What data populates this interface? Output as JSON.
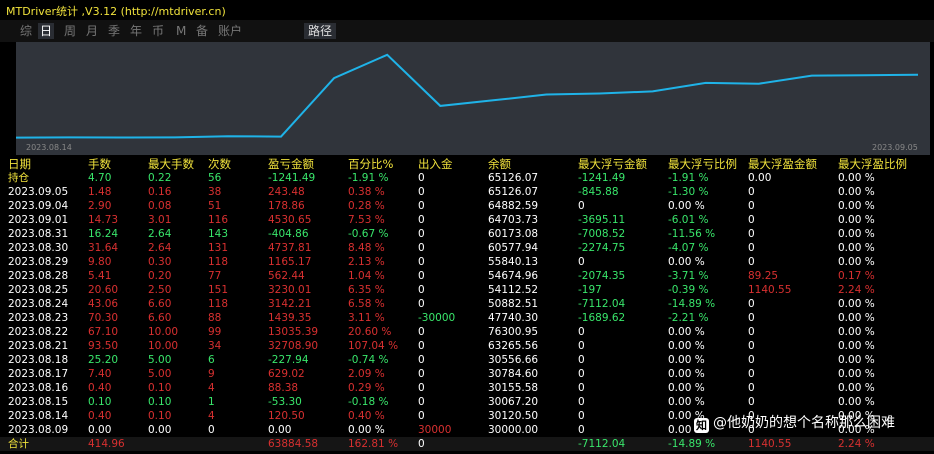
{
  "window": {
    "title": "MTDriver统计 ,V3.12 (http://mtdriver.cn)"
  },
  "tabs": [
    {
      "label": "综",
      "active": false
    },
    {
      "label": "日",
      "active": true
    },
    {
      "label": "周",
      "active": false
    },
    {
      "label": "月",
      "active": false
    },
    {
      "label": "季",
      "active": false
    },
    {
      "label": "年",
      "active": false
    },
    {
      "label": "币",
      "active": false
    },
    {
      "label": "M",
      "active": false
    },
    {
      "label": "备",
      "active": false
    },
    {
      "label": "账户",
      "active": false
    }
  ],
  "path_tab": "路径",
  "chart": {
    "start_label": "2023.08.14",
    "end_label": "2023.09.05",
    "line_color": "#1fb3e8",
    "equity": [
      30000.0,
      30120.5,
      30067.2,
      30155.58,
      30784.6,
      30556.66,
      63265.56,
      76300.95,
      47740.3,
      50882.51,
      54112.52,
      54674.96,
      55840.13,
      60577.94,
      60173.08,
      64703.73,
      64882.59,
      65126.07
    ]
  },
  "colors": {
    "green": "#39e66b",
    "red": "#d83030",
    "white": "#ffffff",
    "header": "#f0e23c"
  },
  "headers": [
    "日期",
    "手数",
    "最大手数",
    "次数",
    "盈亏金额",
    "百分比%",
    "出入金",
    "余额",
    "最大浮亏金额",
    "最大浮亏比例",
    "最大浮盈金额",
    "最大浮盈比例"
  ],
  "rows": [
    [
      "持仓",
      "4.70",
      "0.22",
      "56",
      "-1241.49",
      "-1.91 %",
      "0",
      "65126.07",
      "-1241.49",
      "-1.91 %",
      "0.00",
      "0.00 %"
    ],
    [
      "2023.09.05",
      "1.48",
      "0.16",
      "38",
      "243.48",
      "0.38 %",
      "0",
      "65126.07",
      "-845.88",
      "-1.30 %",
      "0",
      "0.00 %"
    ],
    [
      "2023.09.04",
      "2.90",
      "0.08",
      "51",
      "178.86",
      "0.28 %",
      "0",
      "64882.59",
      "0",
      "0.00 %",
      "0",
      "0.00 %"
    ],
    [
      "2023.09.01",
      "14.73",
      "3.01",
      "116",
      "4530.65",
      "7.53 %",
      "0",
      "64703.73",
      "-3695.11",
      "-6.01 %",
      "0",
      "0.00 %"
    ],
    [
      "2023.08.31",
      "16.24",
      "2.64",
      "143",
      "-404.86",
      "-0.67 %",
      "0",
      "60173.08",
      "-7008.52",
      "-11.56 %",
      "0",
      "0.00 %"
    ],
    [
      "2023.08.30",
      "31.64",
      "2.64",
      "131",
      "4737.81",
      "8.48 %",
      "0",
      "60577.94",
      "-2274.75",
      "-4.07 %",
      "0",
      "0.00 %"
    ],
    [
      "2023.08.29",
      "9.80",
      "0.30",
      "118",
      "1165.17",
      "2.13 %",
      "0",
      "55840.13",
      "0",
      "0.00 %",
      "0",
      "0.00 %"
    ],
    [
      "2023.08.28",
      "5.41",
      "0.20",
      "77",
      "562.44",
      "1.04 %",
      "0",
      "54674.96",
      "-2074.35",
      "-3.71 %",
      "89.25",
      "0.17 %"
    ],
    [
      "2023.08.25",
      "20.60",
      "2.50",
      "151",
      "3230.01",
      "6.35 %",
      "0",
      "54112.52",
      "-197",
      "-0.39 %",
      "1140.55",
      "2.24 %"
    ],
    [
      "2023.08.24",
      "43.06",
      "6.60",
      "118",
      "3142.21",
      "6.58 %",
      "0",
      "50882.51",
      "-7112.04",
      "-14.89 %",
      "0",
      "0.00 %"
    ],
    [
      "2023.08.23",
      "70.30",
      "6.60",
      "88",
      "1439.35",
      "3.11 %",
      "-30000",
      "47740.30",
      "-1689.62",
      "-2.21 %",
      "0",
      "0.00 %"
    ],
    [
      "2023.08.22",
      "67.10",
      "10.00",
      "99",
      "13035.39",
      "20.60 %",
      "0",
      "76300.95",
      "0",
      "0.00 %",
      "0",
      "0.00 %"
    ],
    [
      "2023.08.21",
      "93.50",
      "10.00",
      "34",
      "32708.90",
      "107.04 %",
      "0",
      "63265.56",
      "0",
      "0.00 %",
      "0",
      "0.00 %"
    ],
    [
      "2023.08.18",
      "25.20",
      "5.00",
      "6",
      "-227.94",
      "-0.74 %",
      "0",
      "30556.66",
      "0",
      "0.00 %",
      "0",
      "0.00 %"
    ],
    [
      "2023.08.17",
      "7.40",
      "5.00",
      "9",
      "629.02",
      "2.09 %",
      "0",
      "30784.60",
      "0",
      "0.00 %",
      "0",
      "0.00 %"
    ],
    [
      "2023.08.16",
      "0.40",
      "0.10",
      "4",
      "88.38",
      "0.29 %",
      "0",
      "30155.58",
      "0",
      "0.00 %",
      "0",
      "0.00 %"
    ],
    [
      "2023.08.15",
      "0.10",
      "0.10",
      "1",
      "-53.30",
      "-0.18 %",
      "0",
      "30067.20",
      "0",
      "0.00 %",
      "0",
      "0.00 %"
    ],
    [
      "2023.08.14",
      "0.40",
      "0.10",
      "4",
      "120.50",
      "0.40 %",
      "0",
      "30120.50",
      "0",
      "0.00 %",
      "0",
      "0.00 %"
    ],
    [
      "2023.08.09",
      "0.00",
      "0.00",
      "0",
      "0.00",
      "0.00 %",
      "30000",
      "30000.00",
      "0",
      "0.00 %",
      "0",
      "0.00 %"
    ],
    [
      "合计",
      "414.96",
      "",
      "",
      "63884.58",
      "162.81 %",
      "0",
      "",
      "-7112.04",
      "-14.89 %",
      "1140.55",
      "2.24 %"
    ]
  ],
  "row_colors": [
    "green",
    "red",
    "red",
    "red",
    "green",
    "red",
    "red",
    "red",
    "red",
    "red",
    "red",
    "red",
    "red",
    "green",
    "red",
    "red",
    "green",
    "red",
    "white",
    "red"
  ],
  "col_colors": {
    "headers_row": "header",
    "fixed_white_cols": [
      0,
      6,
      7
    ],
    "note": ""
  },
  "watermark": {
    "logo": "知",
    "text": "@他奶奶的想个名称那么困难"
  }
}
